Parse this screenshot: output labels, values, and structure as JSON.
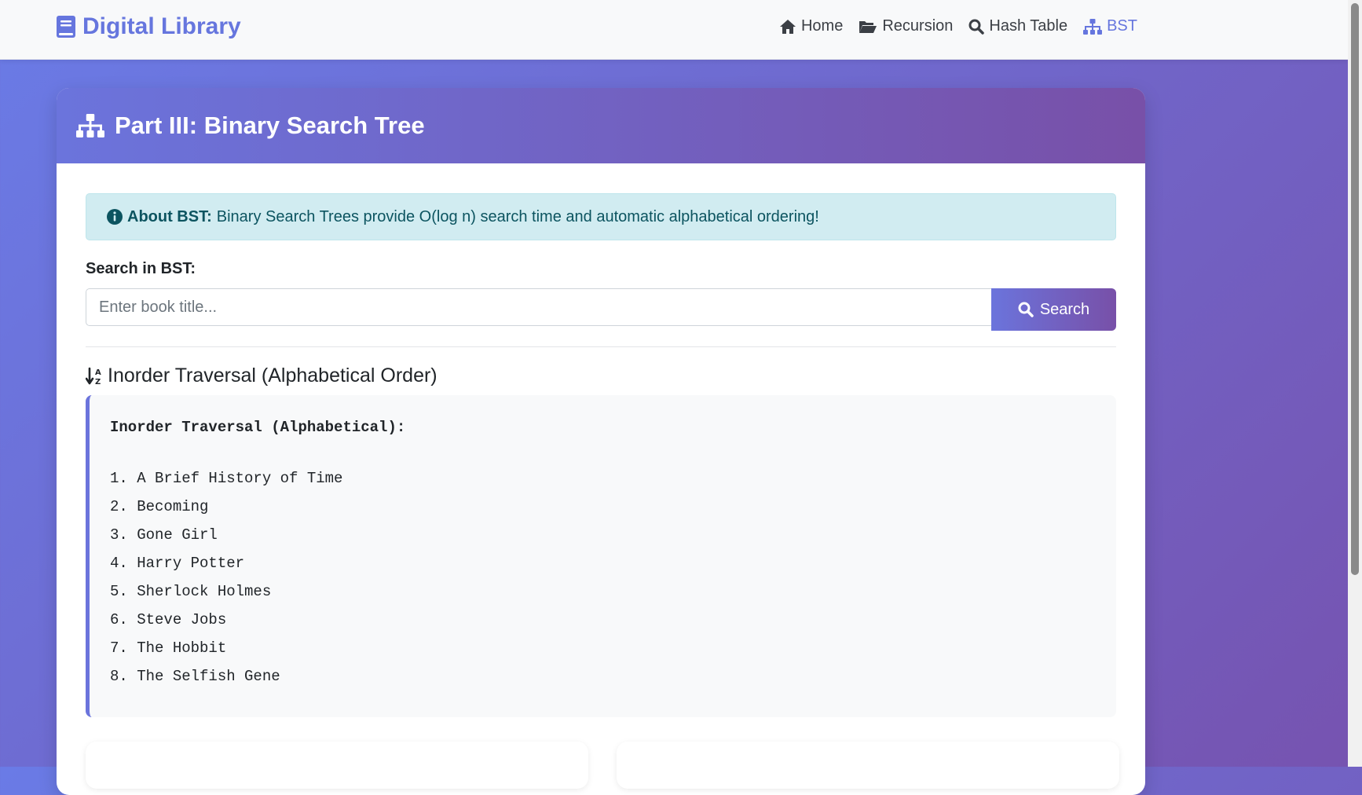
{
  "brand": {
    "title": "Digital Library",
    "icon": "book-icon"
  },
  "nav": {
    "items": [
      {
        "label": "Home",
        "icon": "home-icon",
        "active": false
      },
      {
        "label": "Recursion",
        "icon": "folder-open-icon",
        "active": false
      },
      {
        "label": "Hash Table",
        "icon": "search-icon",
        "active": false
      },
      {
        "label": "BST",
        "icon": "sitemap-icon",
        "active": true
      }
    ]
  },
  "card": {
    "title": "Part III: Binary Search Tree",
    "icon": "sitemap-icon"
  },
  "alert": {
    "icon": "info-circle-icon",
    "strong": "About BST:",
    "text": "Binary Search Trees provide O(log n) search time and automatic alphabetical ordering!"
  },
  "search": {
    "label": "Search in BST:",
    "placeholder": "Enter book title...",
    "value": "",
    "button_label": "Search"
  },
  "inorder": {
    "section_title": "Inorder Traversal (Alphabetical Order)",
    "section_icon": "sort-alpha-down-icon",
    "heading": "Inorder Traversal (Alphabetical):",
    "items": [
      "1. A Brief History of Time",
      "2. Becoming",
      "3. Gone Girl",
      "4. Harry Potter",
      "5. Sherlock Holmes",
      "6. Steve Jobs",
      "7. The Hobbit",
      "8. The Selfish Gene"
    ]
  },
  "colors": {
    "accent": "#6676de",
    "gradient_start": "#6b74dc",
    "gradient_end": "#7850a8",
    "alert_bg": "#d1ecf1",
    "alert_text": "#0c5460"
  }
}
